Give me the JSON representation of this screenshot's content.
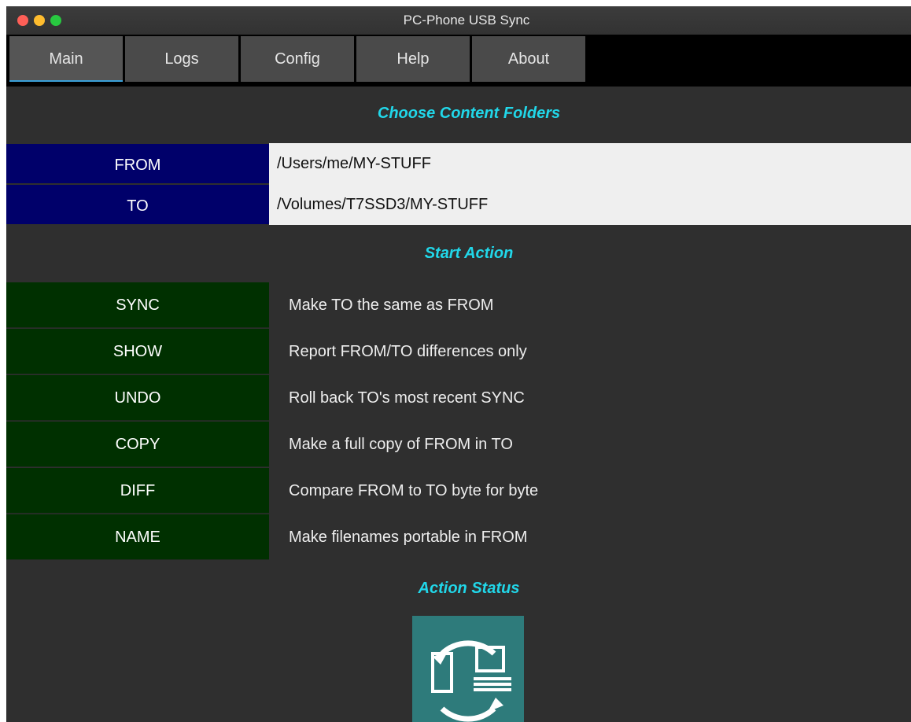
{
  "window": {
    "title": "PC-Phone USB Sync"
  },
  "tabs": [
    {
      "label": "Main",
      "active": true
    },
    {
      "label": "Logs"
    },
    {
      "label": "Config"
    },
    {
      "label": "Help"
    },
    {
      "label": "About"
    }
  ],
  "folders": {
    "heading": "Choose Content Folders",
    "from": {
      "label": "FROM",
      "value": "/Users/me/MY-STUFF"
    },
    "to": {
      "label": "TO",
      "value": "/Volumes/T7SSD3/MY-STUFF"
    }
  },
  "actions": {
    "heading": "Start Action",
    "items": [
      {
        "label": "SYNC",
        "description": "Make TO the same as FROM"
      },
      {
        "label": "SHOW",
        "description": "Report FROM/TO differences only"
      },
      {
        "label": "UNDO",
        "description": "Roll back TO's most recent SYNC"
      },
      {
        "label": "COPY",
        "description": "Make a full copy of FROM in TO"
      },
      {
        "label": "DIFF",
        "description": "Compare FROM to TO byte for byte"
      },
      {
        "label": "NAME",
        "description": "Make filenames portable in FROM"
      }
    ]
  },
  "status": {
    "heading": "Action Status",
    "icon": "phone-laptop-sync-icon"
  },
  "colors": {
    "heading_accent": "#21d7e9",
    "folder_label_bg": "#00006a",
    "action_button_bg": "#003000",
    "status_icon_bg": "#2e7b7b"
  }
}
